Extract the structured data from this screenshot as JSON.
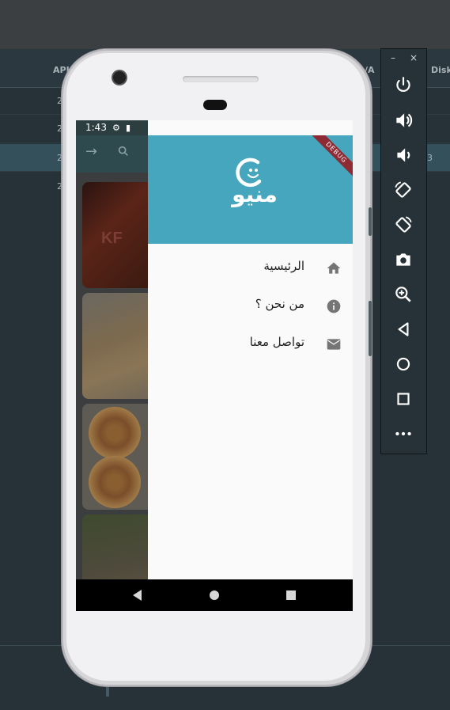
{
  "ide": {
    "columns": [
      "API",
      "/A",
      "Disk"
    ],
    "rows": [
      "2",
      "2",
      "2",
      "2"
    ],
    "selected_row_extra": "3"
  },
  "device": {
    "status": {
      "time": "1:43"
    },
    "debug_banner": "DEBUG",
    "app_logo_text": "منيو",
    "background_card_text": "KF",
    "drawer_items": [
      {
        "label": "الرئيسية",
        "icon": "home-icon"
      },
      {
        "label": "من نحن ؟",
        "icon": "info-icon"
      },
      {
        "label": "تواصل معنا",
        "icon": "email-icon"
      }
    ],
    "colors": {
      "drawer_header": "#46a6bd",
      "drawer_bg": "#fafafa",
      "navbar": "#000000"
    }
  },
  "emulator_panel": {
    "minimize": "–",
    "close": "×",
    "buttons": [
      "power-icon",
      "volume-up-icon",
      "volume-down-icon",
      "rotate-left-icon",
      "rotate-right-icon",
      "camera-icon",
      "zoom-icon",
      "back-icon",
      "home-icon",
      "overview-icon",
      "more-icon"
    ]
  }
}
